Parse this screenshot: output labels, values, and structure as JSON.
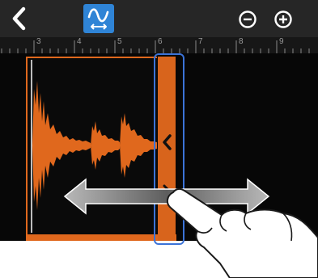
{
  "toolbar": {
    "back_icon": "chevron-left-icon",
    "mode_icon": "waveform-stretch-icon",
    "zoom_out_icon": "zoom-out-icon",
    "zoom_in_icon": "zoom-in-icon",
    "accent": "#2f84d6"
  },
  "ruler": {
    "labels": [
      "3",
      "4",
      "5",
      "6",
      "7",
      "8",
      "9"
    ]
  },
  "clip": {
    "color": "#e0681d",
    "handle_icon": "chevron-left-icon"
  },
  "gesture": {
    "arrow_icon": "double-arrow-icon",
    "hand_icon": "pointing-hand-icon"
  }
}
